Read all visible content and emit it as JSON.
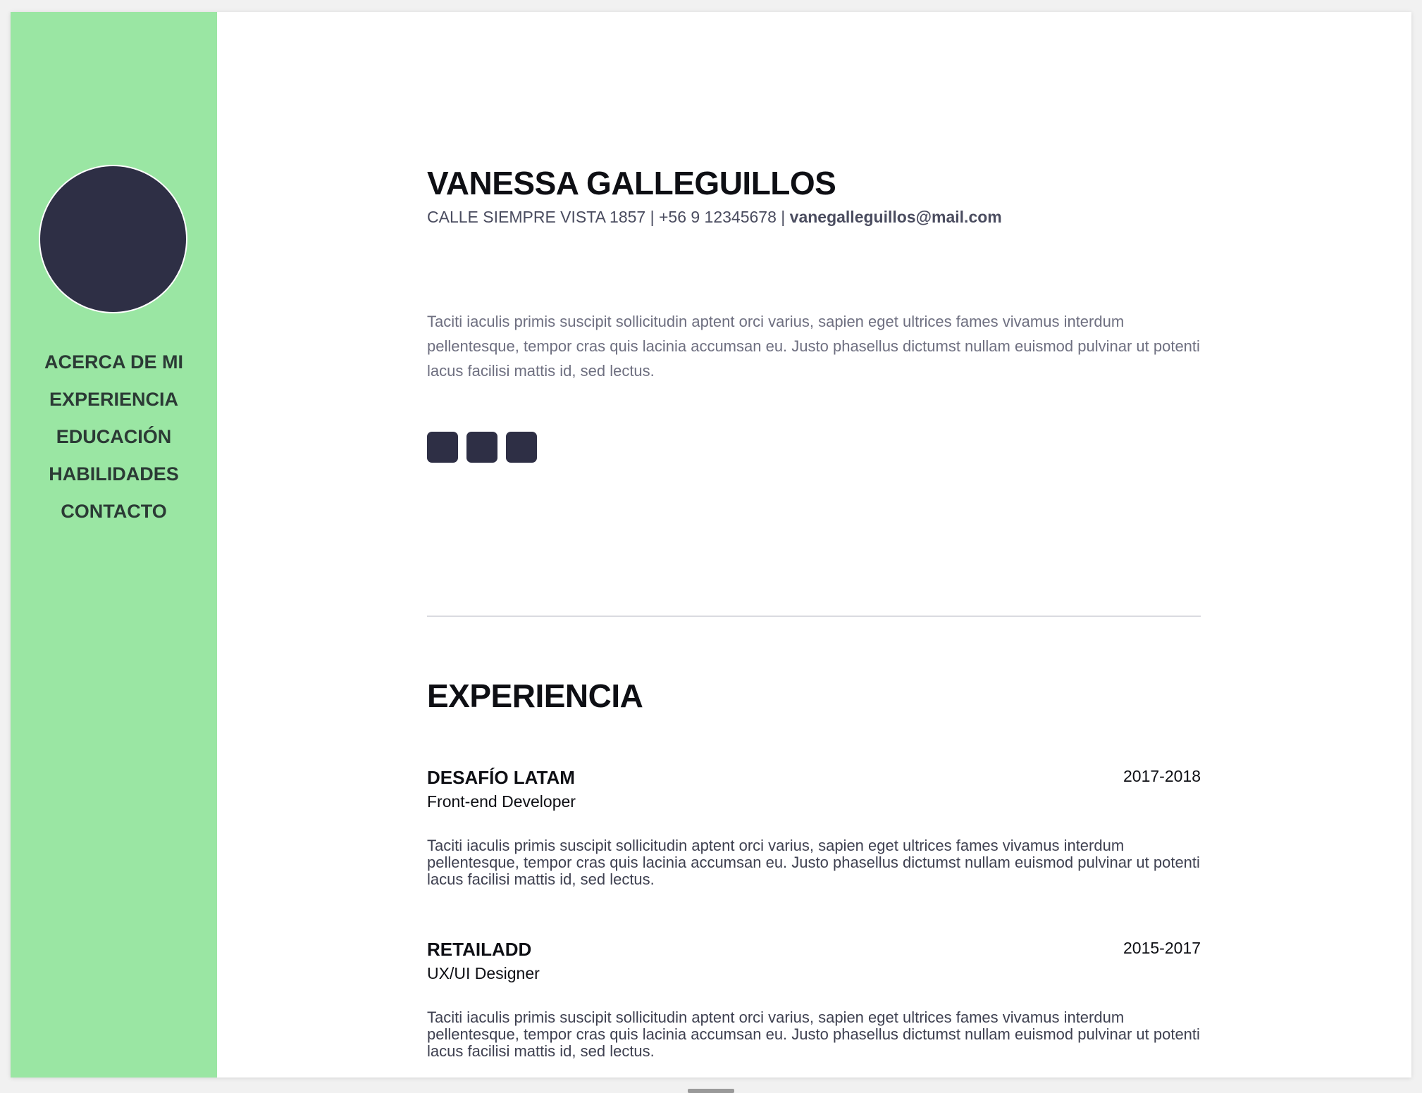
{
  "sidebar": {
    "nav": [
      "ACERCA DE MI",
      "EXPERIENCIA",
      "EDUCACIÓN",
      "HABILIDADES",
      "CONTACTO"
    ]
  },
  "header": {
    "name": "VANESSA GALLEGUILLOS",
    "contact_prefix": "CALLE SIEMPRE VISTA 1857 | +56 9 12345678 | ",
    "email": "vanegalleguillos@mail.com"
  },
  "about": {
    "text": "Taciti iaculis primis suscipit sollicitudin aptent orci varius, sapien eget ultrices fames vivamus interdum pellentesque, tempor cras quis lacinia accumsan eu. Justo phasellus dictumst nullam euismod pulvinar ut potenti lacus facilisi mattis id, sed lectus."
  },
  "experience": {
    "title": "EXPERIENCIA",
    "jobs": [
      {
        "company": "DESAFÍO LATAM",
        "role": "Front-end Developer",
        "years": "2017-2018",
        "description": "Taciti iaculis primis suscipit sollicitudin aptent orci varius, sapien eget ultrices fames vivamus interdum pellentesque, tempor cras quis lacinia accumsan eu. Justo phasellus dictumst nullam euismod pulvinar ut potenti lacus facilisi mattis id, sed lectus."
      },
      {
        "company": "RETAILADD",
        "role": "UX/UI Designer",
        "years": "2015-2017",
        "description": "Taciti iaculis primis suscipit sollicitudin aptent orci varius, sapien eget ultrices fames vivamus interdum pellentesque, tempor cras quis lacinia accumsan eu. Justo phasellus dictumst nullam euismod pulvinar ut potenti lacus facilisi mattis id, sed lectus."
      }
    ]
  },
  "colors": {
    "sidebar": "#9ae6a3",
    "dark": "#2e2f45",
    "text": "#0e0f14"
  }
}
